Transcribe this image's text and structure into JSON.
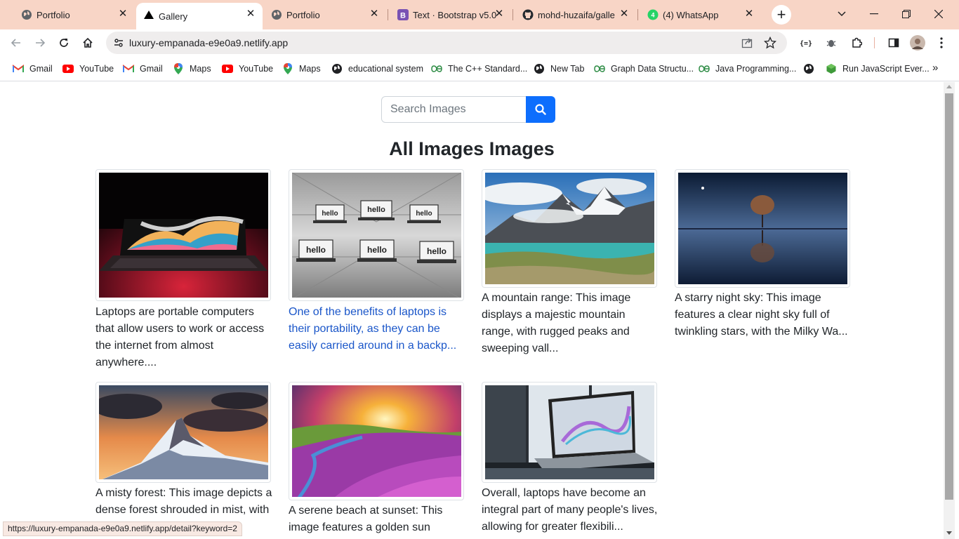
{
  "browser": {
    "tabs": [
      {
        "title": "Portfolio",
        "favicon": "globe-icon"
      },
      {
        "title": "Gallery",
        "favicon": "vercel-triangle-icon",
        "active": true
      },
      {
        "title": "Portfolio",
        "favicon": "globe-icon"
      },
      {
        "title": "Text · Bootstrap v5.0",
        "favicon": "bootstrap-icon"
      },
      {
        "title": "mohd-huzaifa/galle",
        "favicon": "github-icon"
      },
      {
        "title": "(4) WhatsApp",
        "favicon": "whatsapp-icon"
      }
    ],
    "url": "luxury-empanada-e9e0a9.netlify.app",
    "status_url": "https://luxury-empanada-e9e0a9.netlify.app/detail?keyword=2"
  },
  "bookmarks": [
    {
      "label": "Gmail",
      "icon": "gmail-icon"
    },
    {
      "label": "YouTube",
      "icon": "youtube-icon"
    },
    {
      "label": "Gmail",
      "icon": "gmail-icon"
    },
    {
      "label": "Maps",
      "icon": "maps-icon"
    },
    {
      "label": "YouTube",
      "icon": "youtube-icon"
    },
    {
      "label": "Maps",
      "icon": "maps-icon"
    },
    {
      "label": "educational system",
      "icon": "globe-icon"
    },
    {
      "label": "The C++ Standard...",
      "icon": "gfg-icon"
    },
    {
      "label": "New Tab",
      "icon": "globe-icon"
    },
    {
      "label": "Graph Data Structu...",
      "icon": "gfg-icon"
    },
    {
      "label": "Java Programming...",
      "icon": "gfg-icon"
    },
    {
      "label": "",
      "icon": "globe-icon"
    },
    {
      "label": "Run JavaScript Ever...",
      "icon": "runjs-icon"
    }
  ],
  "page": {
    "search": {
      "placeholder": "Search Images"
    },
    "heading": "All Images Images",
    "cards": [
      {
        "caption": "Laptops are portable computers that allow users to work or access the internet from almost anywhere....",
        "image": "laptop-colorful-screen"
      },
      {
        "caption": "One of the benefits of laptops is their portability, as they can be easily carried around in a backp...",
        "image": "laptops-hello-grid",
        "hovered": true
      },
      {
        "caption": "A mountain range: This image displays a majestic mountain range, with rugged peaks and sweeping vall...",
        "image": "mountain-lake"
      },
      {
        "caption": "A starry night sky: This image features a clear night sky full of twinkling stars, with the Milky Wa...",
        "image": "tree-reflection-night"
      },
      {
        "caption": "A misty forest: This image depicts a dense forest shrouded in mist, with",
        "image": "mountain-peak-sunset"
      },
      {
        "caption": "A serene beach at sunset: This image features a golden sun",
        "image": "flower-hill-sunrise"
      },
      {
        "caption": "Overall, laptops have become an integral part of many people's lives, allowing for greater flexibili...",
        "image": "laptop-window"
      }
    ]
  },
  "colors": {
    "accent": "#0d6efd",
    "tabstrip": "#f8d5c6",
    "link": "#1a56c9"
  }
}
